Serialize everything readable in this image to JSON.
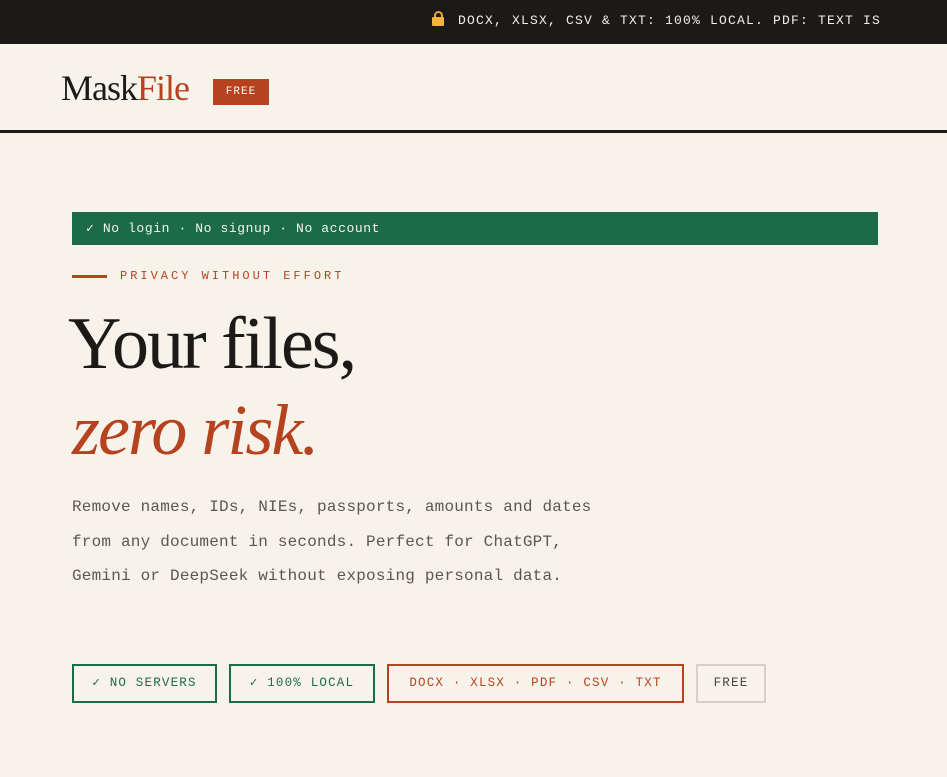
{
  "topbar": {
    "lock_icon": "lock-icon",
    "text": "DOCX, XLSX, CSV & TXT: 100% LOCAL. PDF: TEXT IS"
  },
  "header": {
    "logo_part1": "Mask",
    "logo_part2": "File",
    "badge": "FREE"
  },
  "hero": {
    "nologin_banner": "✓ No login · No signup · No account",
    "eyebrow": "PRIVACY WITHOUT EFFORT",
    "headline_line1": "Your files,",
    "headline_line2": "zero risk.",
    "description": "Remove names, IDs, NIEs, passports, amounts and dates from any document in seconds. Perfect for ChatGPT, Gemini or DeepSeek without exposing personal data."
  },
  "chips": {
    "no_servers": "✓ NO SERVERS",
    "local": "✓ 100% LOCAL",
    "formats": "DOCX · XLSX · PDF · CSV · TXT",
    "free": "FREE"
  },
  "colors": {
    "topbar_bg": "#1b1a16",
    "page_bg": "#f7f3ea",
    "accent": "#b6431f",
    "green": "#1d6b44",
    "lock": "#f2b43a"
  }
}
